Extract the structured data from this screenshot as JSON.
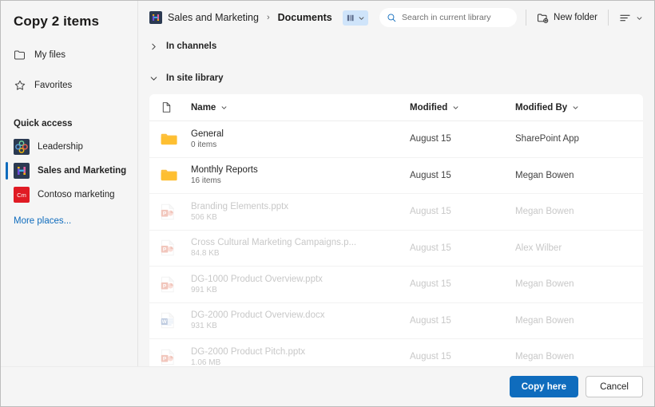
{
  "dialog": {
    "title": "Copy 2 items"
  },
  "sidebar": {
    "nav": [
      {
        "label": "My files",
        "icon": "folder-icon"
      },
      {
        "label": "Favorites",
        "icon": "star-icon"
      }
    ],
    "quick_access_heading": "Quick access",
    "quick_access": [
      {
        "label": "Leadership",
        "icon": "leadership-site-icon",
        "selected": false
      },
      {
        "label": "Sales and Marketing",
        "icon": "sales-marketing-site-icon",
        "selected": true
      },
      {
        "label": "Contoso marketing",
        "icon": "contoso-marketing-site-icon",
        "selected": false,
        "initials": "Cm"
      }
    ],
    "more_places": "More places..."
  },
  "topbar": {
    "breadcrumb": {
      "site": "Sales and Marketing",
      "separator": "›",
      "current": "Documents"
    },
    "library_badge_icon": "library-books-icon",
    "library_badge_chevron": "chevron-down-icon",
    "search": {
      "placeholder": "Search in current library",
      "value": "",
      "icon": "search-icon"
    },
    "new_folder": {
      "label": "New folder",
      "icon": "new-folder-icon"
    },
    "view_options": {
      "icon": "list-view-icon",
      "chevron": "chevron-down-icon"
    }
  },
  "sections": [
    {
      "label": "In channels",
      "expanded": false,
      "chevron": "chevron-right-icon"
    },
    {
      "label": "In site library",
      "expanded": true,
      "chevron": "chevron-down-icon"
    }
  ],
  "table": {
    "columns": {
      "icon": "file-type-icon",
      "name": "Name",
      "modified": "Modified",
      "modified_by": "Modified By"
    },
    "sort_chevron": "chevron-down-icon",
    "rows": [
      {
        "name": "General",
        "sub": "0 items",
        "modified": "August 15",
        "modified_by": "SharePoint App",
        "icon": "folder-icon",
        "disabled": false
      },
      {
        "name": "Monthly Reports",
        "sub": "16 items",
        "modified": "August 15",
        "modified_by": "Megan Bowen",
        "icon": "folder-icon",
        "disabled": false
      },
      {
        "name": "Branding Elements.pptx",
        "sub": "506 KB",
        "modified": "August 15",
        "modified_by": "Megan Bowen",
        "icon": "powerpoint-icon",
        "disabled": true
      },
      {
        "name": "Cross Cultural Marketing Campaigns.p...",
        "sub": "84.8 KB",
        "modified": "August 15",
        "modified_by": "Alex Wilber",
        "icon": "powerpoint-icon",
        "disabled": true
      },
      {
        "name": "DG-1000 Product Overview.pptx",
        "sub": "991 KB",
        "modified": "August 15",
        "modified_by": "Megan Bowen",
        "icon": "powerpoint-icon",
        "disabled": true
      },
      {
        "name": "DG-2000 Product Overview.docx",
        "sub": "931 KB",
        "modified": "August 15",
        "modified_by": "Megan Bowen",
        "icon": "word-icon",
        "disabled": true
      },
      {
        "name": "DG-2000 Product Pitch.pptx",
        "sub": "1.06 MB",
        "modified": "August 15",
        "modified_by": "Megan Bowen",
        "icon": "powerpoint-icon",
        "disabled": true
      }
    ]
  },
  "footer": {
    "primary": "Copy here",
    "secondary": "Cancel"
  },
  "colors": {
    "accent": "#0f6cbd",
    "folder": "#fdc040",
    "powerpoint": "#d24726",
    "word": "#2b579a",
    "link": "#0f6cbd",
    "disabled_text": "#c8c8c8"
  }
}
